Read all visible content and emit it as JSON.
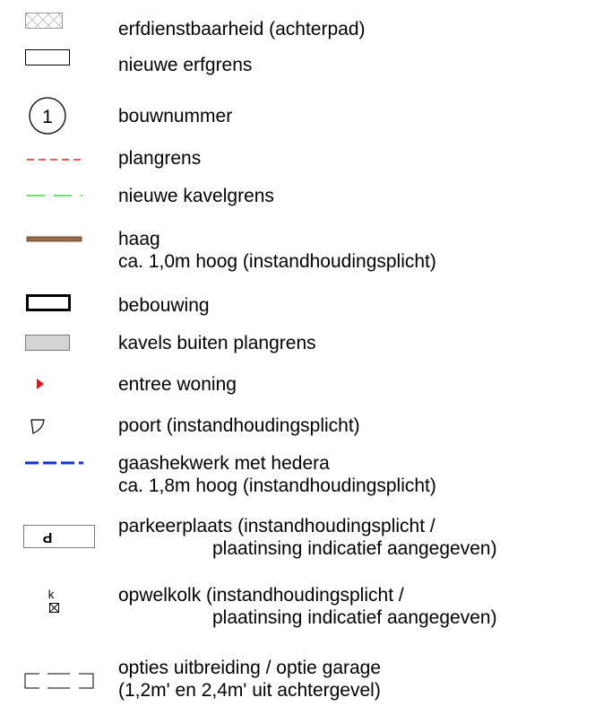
{
  "legend": {
    "items": [
      {
        "key": "erfdienstbaarheid",
        "icon": "hatched-rectangle-icon",
        "lines": [
          "erfdienstbaarheid (achterpad)"
        ]
      },
      {
        "key": "erfgrens",
        "icon": "outline-rectangle-icon",
        "lines": [
          "nieuwe erfgrens"
        ]
      },
      {
        "key": "bouwnummer",
        "icon": "numbered-circle-icon",
        "symbol_text": "1",
        "lines": [
          "bouwnummer"
        ]
      },
      {
        "key": "plangrens",
        "icon": "red-dashed-line-icon",
        "color": "#e8262a",
        "lines": [
          "plangrens"
        ]
      },
      {
        "key": "kavelgrens",
        "icon": "green-dashed-line-icon",
        "color": "#33dd33",
        "lines": [
          "nieuwe kavelgrens"
        ]
      },
      {
        "key": "haag",
        "icon": "brown-bar-icon",
        "color": "#9a6a4a",
        "lines": [
          "haag",
          "ca. 1,0m hoog (instandhoudingsplicht)"
        ]
      },
      {
        "key": "bebouwing",
        "icon": "thick-rectangle-icon",
        "lines": [
          "bebouwing"
        ]
      },
      {
        "key": "kavels-buiten",
        "icon": "grey-rectangle-icon",
        "color": "#d4d4d4",
        "lines": [
          "kavels buiten plangrens"
        ]
      },
      {
        "key": "entree",
        "icon": "red-triangle-icon",
        "color": "#ee1111",
        "lines": [
          "entree woning"
        ]
      },
      {
        "key": "poort",
        "icon": "gate-icon",
        "lines": [
          "poort (instandhoudingsplicht)"
        ]
      },
      {
        "key": "gaashekwerk",
        "icon": "blue-dashed-line-icon",
        "color": "#1133cc",
        "lines": [
          "gaashekwerk met hedera",
          "ca. 1,8m hoog (instandhoudingsplicht)"
        ]
      },
      {
        "key": "parkeerplaats",
        "icon": "parking-icon",
        "symbol_text": "P",
        "lines": [
          "parkeerplaats (instandhoudingsplicht /",
          "plaatinsing indicatief aangegeven)"
        ]
      },
      {
        "key": "opwelkolk",
        "icon": "drain-icon",
        "symbol_text": "k",
        "lines": [
          "opwelkolk (instandhoudingsplicht /",
          "plaatinsing indicatief aangegeven)"
        ]
      },
      {
        "key": "opties",
        "icon": "dashed-bracket-icon",
        "lines": [
          "opties uitbreiding / optie garage",
          "(1,2m' en 2,4m' uit achtergevel)"
        ]
      }
    ]
  }
}
